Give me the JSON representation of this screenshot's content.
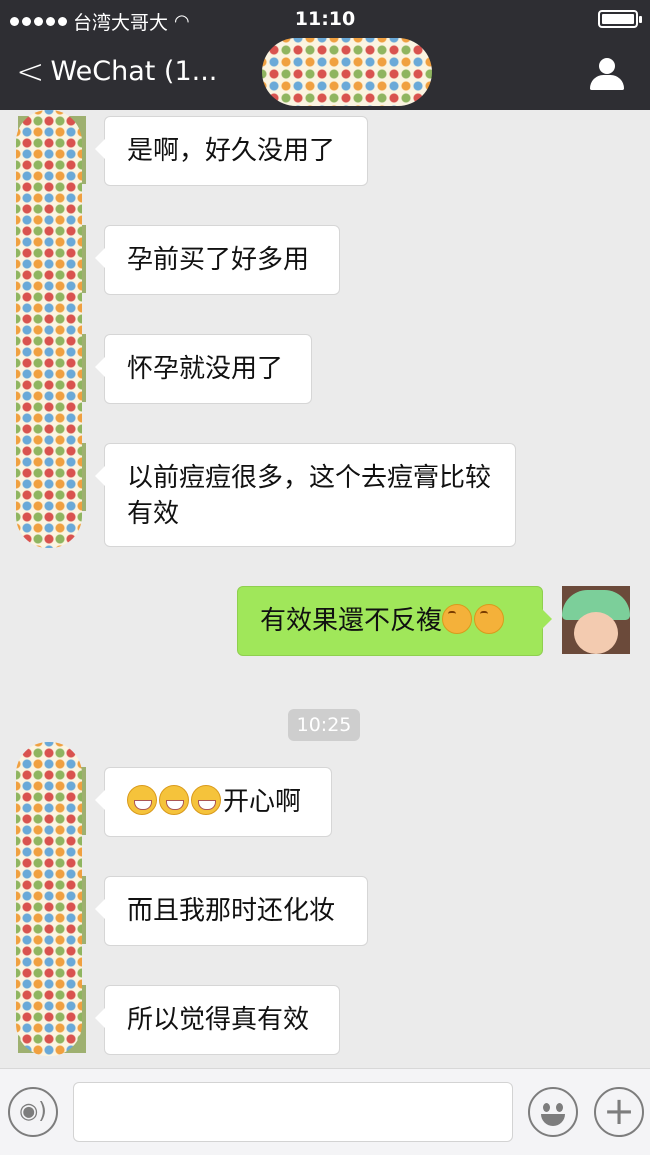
{
  "status_bar": {
    "carrier": "台湾大哥大",
    "time": "11:10"
  },
  "nav": {
    "back_label": "WeChat (1..."
  },
  "messages": [
    {
      "side": "received",
      "text": "是啊，好久没用了"
    },
    {
      "side": "received",
      "text": "孕前买了好多用"
    },
    {
      "side": "received",
      "text": "怀孕就没用了"
    },
    {
      "side": "received",
      "text": "以前痘痘很多，这个去痘膏比较有效"
    },
    {
      "side": "sent",
      "text": "有效果還不反複",
      "emojis": [
        "hug-emoji",
        "hug-emoji"
      ]
    },
    {
      "side": "received",
      "text": "开心啊",
      "emojis": [
        "grin-emoji",
        "grin-emoji",
        "grin-emoji"
      ]
    },
    {
      "side": "received",
      "text": "而且我那时还化妆"
    },
    {
      "side": "received",
      "text": "所以觉得真有效"
    }
  ],
  "timestamp": "10:25",
  "colors": {
    "nav_bg": "#2e2e33",
    "sent_bubble": "#a0e75a",
    "chat_bg": "#ebebeb"
  }
}
